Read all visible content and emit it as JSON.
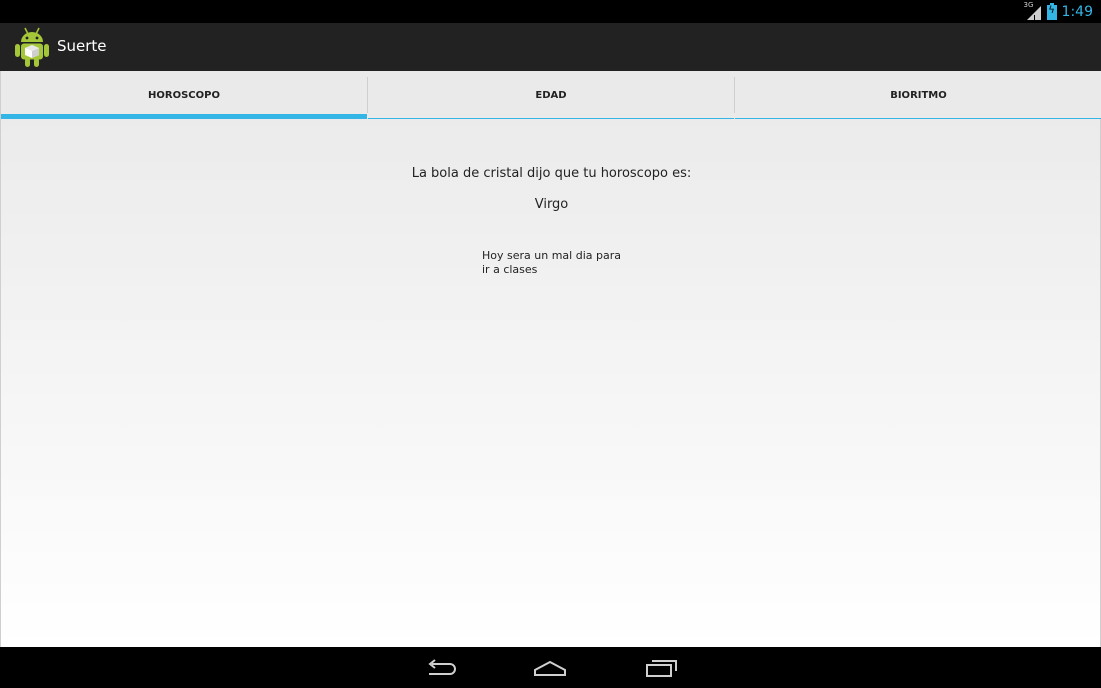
{
  "status_bar": {
    "network_type": "3G",
    "time": "1:49"
  },
  "action_bar": {
    "title": "Suerte"
  },
  "tabs": [
    {
      "label": "HOROSCOPO",
      "selected": true
    },
    {
      "label": "EDAD",
      "selected": false
    },
    {
      "label": "BIORITMO",
      "selected": false
    }
  ],
  "content": {
    "prompt": "La bola de cristal dijo que tu horoscopo es:",
    "sign": "Virgo",
    "prediction_line1": "Hoy sera un mal dia para",
    "prediction_line2": "ir a clases"
  },
  "nav_bar": {
    "back_icon": "back-icon",
    "home_icon": "home-icon",
    "recents_icon": "recents-icon"
  },
  "colors": {
    "accent": "#33b5e5",
    "action_bar": "#222222",
    "tab_bar": "#eaeaea"
  }
}
